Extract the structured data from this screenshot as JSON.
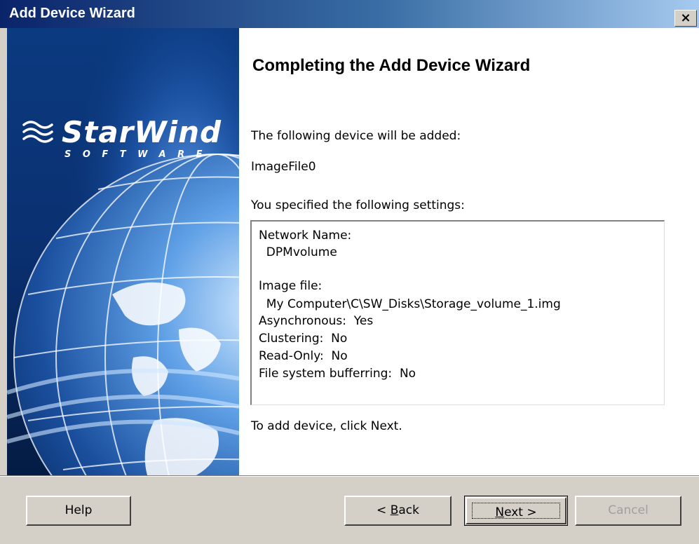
{
  "window": {
    "title": "Add Device Wizard",
    "close_glyph": "×"
  },
  "banner": {
    "brand": "StarWind",
    "brand_sub": "SOFTWARE",
    "logo_icon": "wave-logo-icon",
    "background_image": "globe-illustration"
  },
  "content": {
    "heading": "Completing the Add Device Wizard",
    "device_intro": "The following device will be added:",
    "device_name": "ImageFile0",
    "settings_intro": "You specified the following settings:",
    "settings_lines": [
      "Network Name:",
      "  DPMvolume",
      "",
      "Image file:",
      "  My Computer\\C\\SW_Disks\\Storage_volume_1.img",
      "Asynchronous:  Yes",
      "Clustering:  No",
      "Read-Only:  No",
      "File system bufferring:  No"
    ],
    "footer_hint": "To add device, click Next."
  },
  "buttons": {
    "help": "Help",
    "back_prefix": "< ",
    "back_mnemonic": "B",
    "back_rest": "ack",
    "next_mnemonic": "N",
    "next_rest": "ext >",
    "cancel": "Cancel"
  },
  "colors": {
    "titlebar_start": "#0a246a",
    "titlebar_end": "#a6caf0",
    "dialog_face": "#d4d0c8",
    "banner_blue": "#062a62",
    "disabled_text": "#a0a0a0"
  }
}
